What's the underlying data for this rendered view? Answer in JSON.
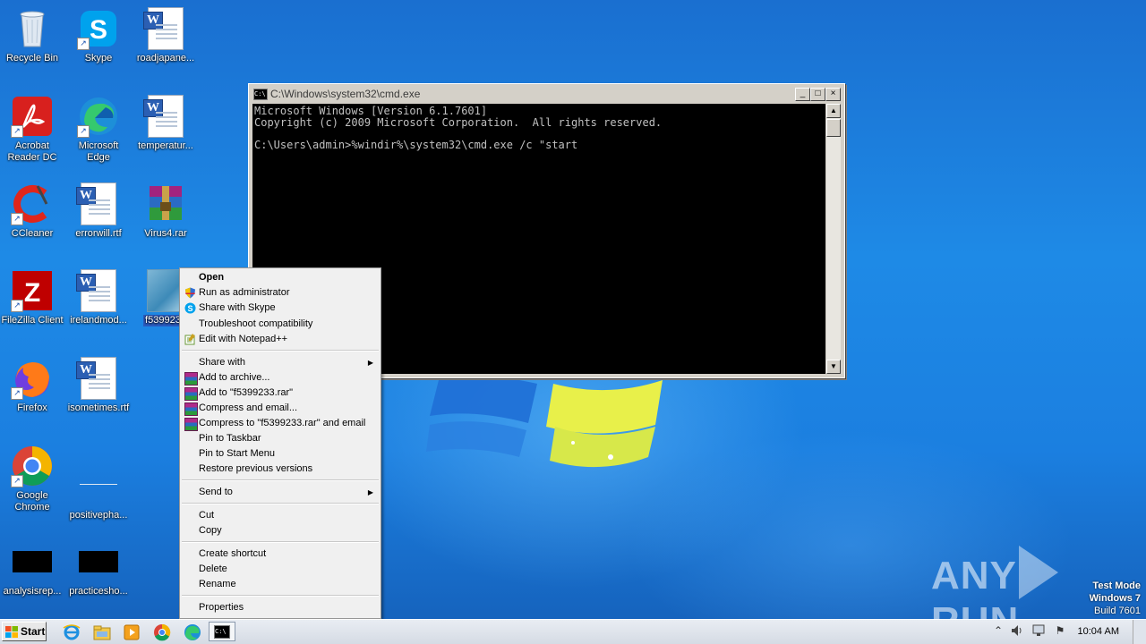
{
  "desktop_icons": [
    {
      "id": "recycle-bin",
      "label": "Recycle Bin"
    },
    {
      "id": "skype",
      "label": "Skype"
    },
    {
      "id": "roadjapanese",
      "label": "roadjapane..."
    },
    {
      "id": "acrobat",
      "label": "Acrobat Reader DC"
    },
    {
      "id": "edge",
      "label": "Microsoft Edge"
    },
    {
      "id": "temperature",
      "label": "temperatur..."
    },
    {
      "id": "ccleaner",
      "label": "CCleaner"
    },
    {
      "id": "errorwill",
      "label": "errorwill.rtf"
    },
    {
      "id": "virus4",
      "label": "Virus4.rar"
    },
    {
      "id": "filezilla",
      "label": "FileZilla Client"
    },
    {
      "id": "irelandmod",
      "label": "irelandmod..."
    },
    {
      "id": "f5399233",
      "label": "f5399233"
    },
    {
      "id": "firefox",
      "label": "Firefox"
    },
    {
      "id": "isometimes",
      "label": "isometimes.rtf"
    },
    {
      "id": "chrome",
      "label": "Google Chrome"
    },
    {
      "id": "positivepha",
      "label": "positivepha..."
    },
    {
      "id": "analysisrep",
      "label": "analysisrep..."
    },
    {
      "id": "practicesho",
      "label": "practicesho..."
    }
  ],
  "cmd_window": {
    "title": "C:\\Windows\\system32\\cmd.exe",
    "icon_text": "C:\\",
    "buttons": {
      "minimize": "_",
      "maximize": "□",
      "close": "×"
    },
    "console_text": "Microsoft Windows [Version 6.1.7601]\nCopyright (c) 2009 Microsoft Corporation.  All rights reserved.\n\nC:\\Users\\admin>%windir%\\system32\\cmd.exe /c \"start"
  },
  "context_menu": {
    "items": [
      {
        "label": "Open",
        "bold": true,
        "icon": ""
      },
      {
        "label": "Run as administrator",
        "icon": "uac-shield-icon"
      },
      {
        "label": "Share with Skype",
        "icon": "skype-icon"
      },
      {
        "label": "Troubleshoot compatibility",
        "icon": ""
      },
      {
        "label": "Edit with Notepad++",
        "icon": "notepadpp-icon"
      },
      {
        "label": "Share with",
        "submenu": true
      },
      {
        "label": "Add to archive...",
        "icon": "winrar-icon"
      },
      {
        "label": "Add to \"f5399233.rar\"",
        "icon": "winrar-icon"
      },
      {
        "label": "Compress and email...",
        "icon": "winrar-icon"
      },
      {
        "label": "Compress to \"f5399233.rar\" and email",
        "icon": "winrar-icon"
      },
      {
        "label": "Pin to Taskbar"
      },
      {
        "label": "Pin to Start Menu"
      },
      {
        "label": "Restore previous versions"
      },
      {
        "label": "Send to",
        "submenu": true
      },
      {
        "label": "Cut"
      },
      {
        "label": "Copy"
      },
      {
        "label": "Create shortcut"
      },
      {
        "label": "Delete"
      },
      {
        "label": "Rename"
      },
      {
        "label": "Properties"
      }
    ],
    "submenu_arrow": "▶"
  },
  "taskbar": {
    "start_label": "Start",
    "pinned": [
      "ie-icon",
      "explorer-icon",
      "media-player-icon",
      "chrome-icon",
      "edge-icon",
      "cmd-icon"
    ],
    "cmd_icon_text": "C:\\",
    "tray": {
      "expand": "⌃",
      "flag": "⚑"
    },
    "clock": "10:04 AM"
  },
  "watermark": {
    "left": "ANY",
    "right": "RUN"
  },
  "test_mode": {
    "line1": "Test Mode",
    "line2": "Windows 7",
    "line3": "Build 7601"
  },
  "colors": {
    "desktop_blue": "#1b7fe0",
    "menu_bg": "#f0f0f0",
    "console_bg": "#000000",
    "console_fg": "#c0c0c0",
    "selection": "#2a5bbf"
  }
}
